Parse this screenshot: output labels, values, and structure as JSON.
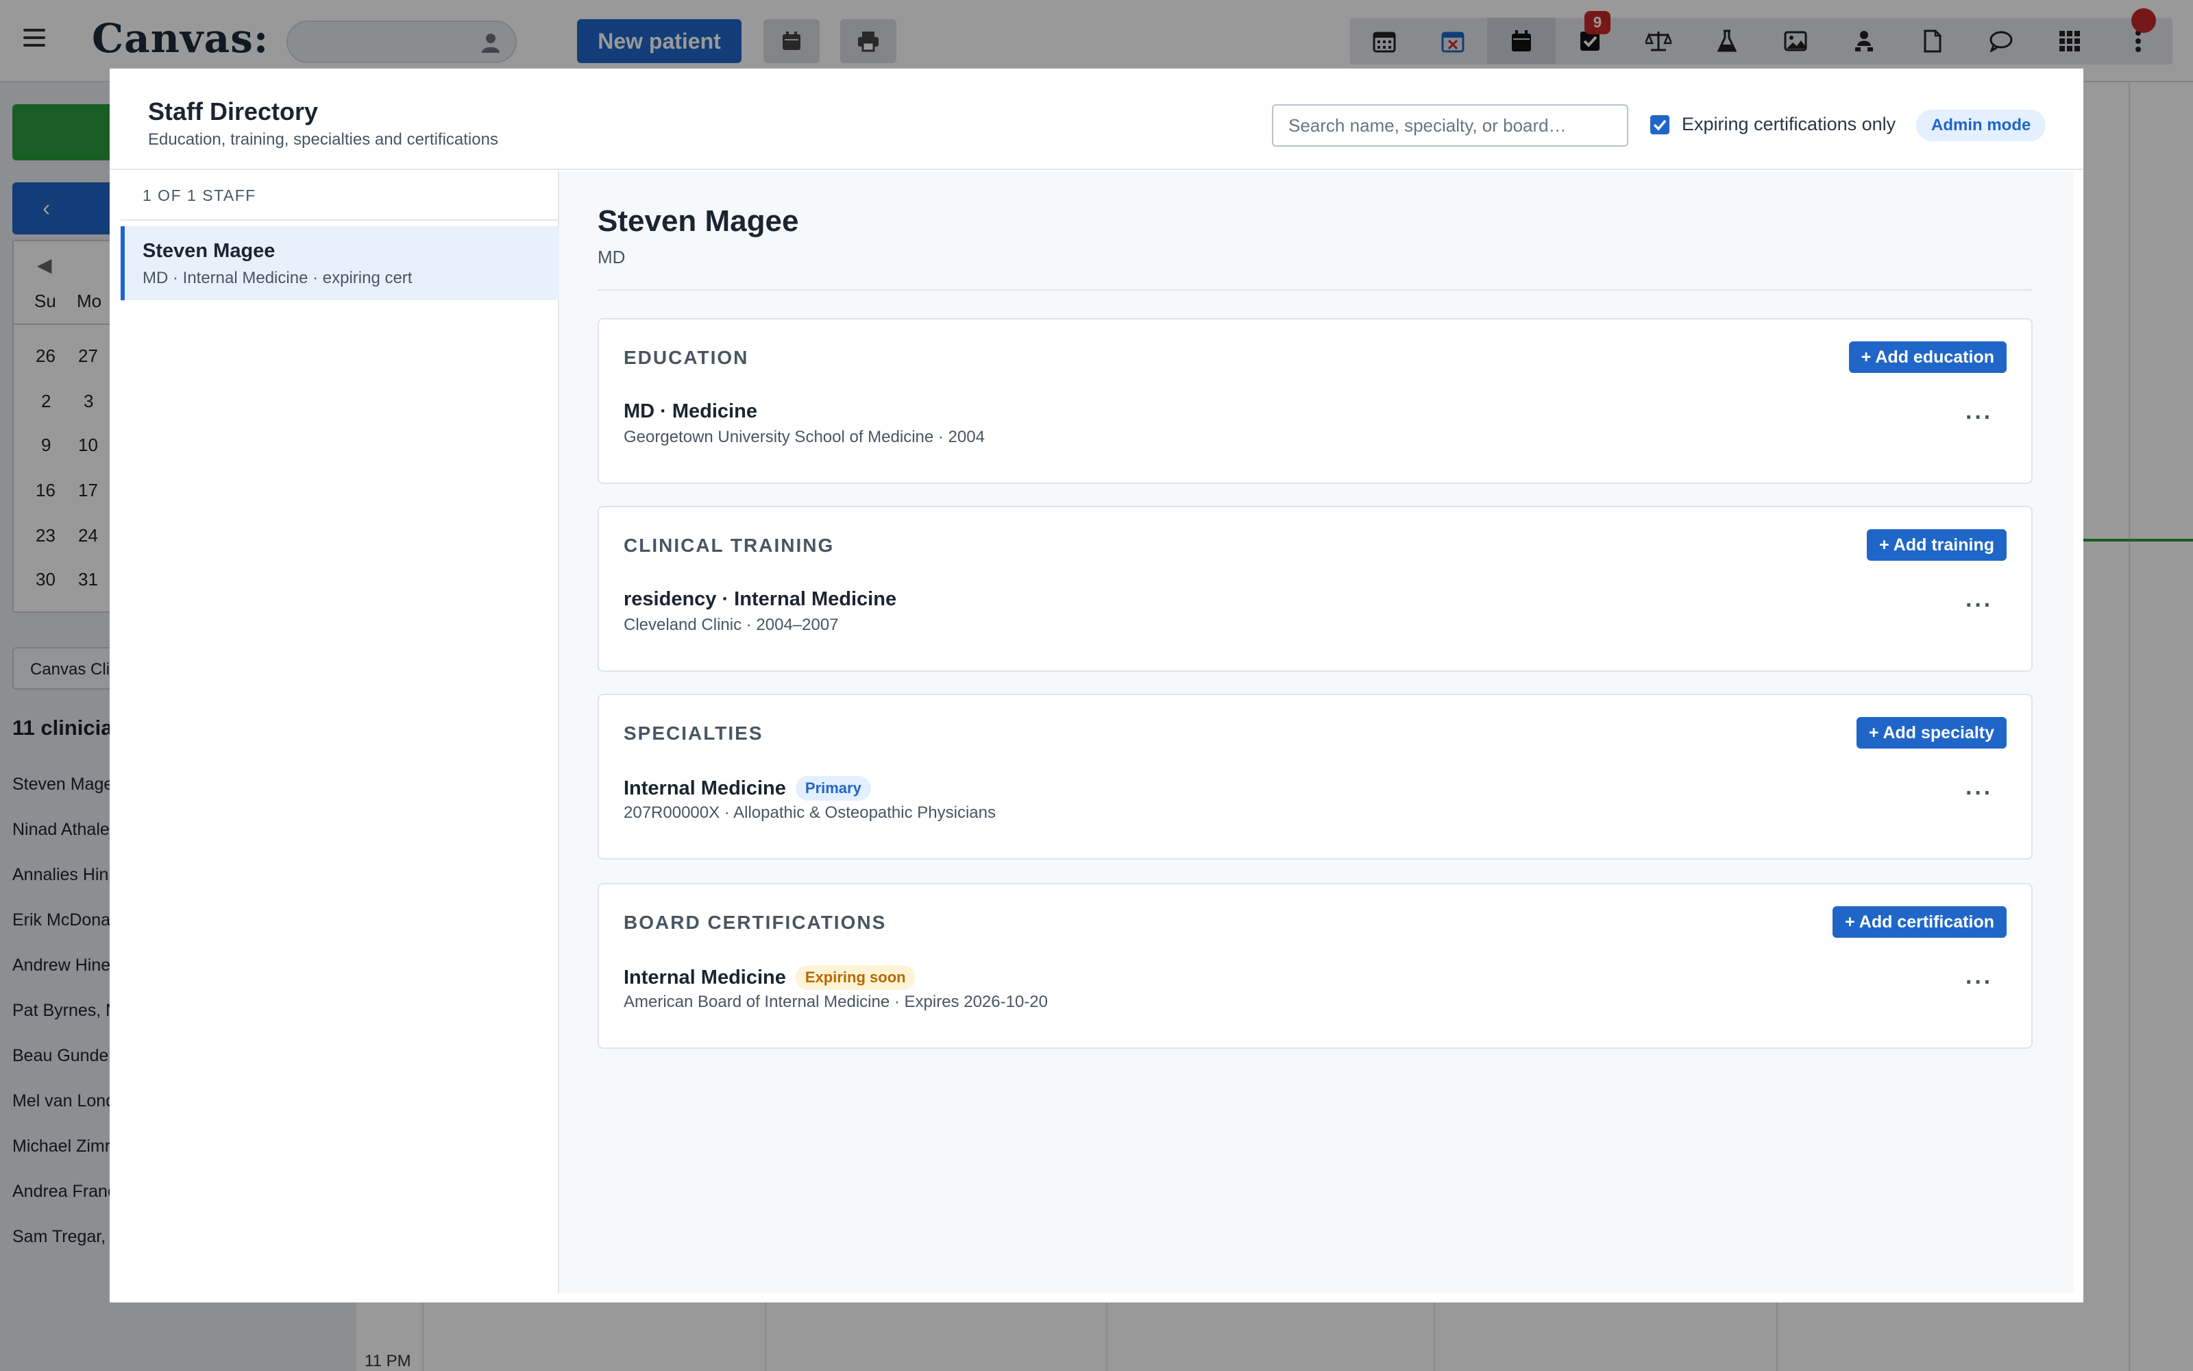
{
  "app": {
    "logo": "Canvas:",
    "new_patient_label": "New patient",
    "task_badge_count": "9",
    "toolbar_icons": [
      "calendar-grid-icon",
      "calendar-cancel-icon",
      "calendar-icon",
      "tasks-icon",
      "scale-icon",
      "lab-flask-icon",
      "image-icon",
      "user-network-icon",
      "document-icon",
      "chat-icon",
      "apps-grid-icon",
      "more-vertical-icon"
    ]
  },
  "background": {
    "mini_calendar": {
      "day_headers": [
        "Su",
        "Mo"
      ],
      "rows": [
        [
          "26",
          "27"
        ],
        [
          "2",
          "3"
        ],
        [
          "9",
          "10"
        ],
        [
          "16",
          "17"
        ],
        [
          "23",
          "24"
        ],
        [
          "30",
          "31"
        ]
      ]
    },
    "location_button": "Canvas Clin",
    "clinician_count": "11 clinicia",
    "clinicians": [
      "Steven Mage",
      "Ninad Athale",
      "Annalies Hin",
      "Erik McDona",
      "Andrew Hine",
      "Pat Byrnes, N",
      "Beau Gunder",
      "Mel van Lond",
      "Michael Zimr",
      "Andrea Franc",
      "Sam Tregar, D"
    ],
    "time_label": "11 PM"
  },
  "modal": {
    "title": "Staff Directory",
    "subtitle": "Education, training, specialties and certifications",
    "search_placeholder": "Search name, specialty, or board…",
    "expiring_only_label": "Expiring certifications only",
    "admin_mode_label": "Admin mode",
    "staff_count": "1 OF 1 STAFF",
    "staff_list": [
      {
        "name": "Steven Magee",
        "meta": "MD · Internal Medicine · expiring cert"
      }
    ],
    "profile": {
      "name": "Steven Magee",
      "credential": "MD",
      "sections": [
        {
          "title": "EDUCATION",
          "add_label": "+ Add education",
          "entry_title": "MD · Medicine",
          "entry_tag": "",
          "entry_sub": "Georgetown University School of Medicine · 2004"
        },
        {
          "title": "CLINICAL TRAINING",
          "add_label": "+ Add training",
          "entry_title": "residency · Internal Medicine",
          "entry_tag": "",
          "entry_sub": "Cleveland Clinic · 2004–2007"
        },
        {
          "title": "SPECIALTIES",
          "add_label": "+ Add specialty",
          "entry_title": "Internal Medicine",
          "entry_tag": "Primary",
          "entry_sub": "207R00000X · Allopathic & Osteopathic Physicians"
        },
        {
          "title": "BOARD CERTIFICATIONS",
          "add_label": "+ Add certification",
          "entry_title": "Internal Medicine",
          "entry_tag": "Expiring soon",
          "entry_sub": "American Board of Internal Medicine · Expires 2026-10-20"
        }
      ],
      "more_label": "···"
    }
  }
}
